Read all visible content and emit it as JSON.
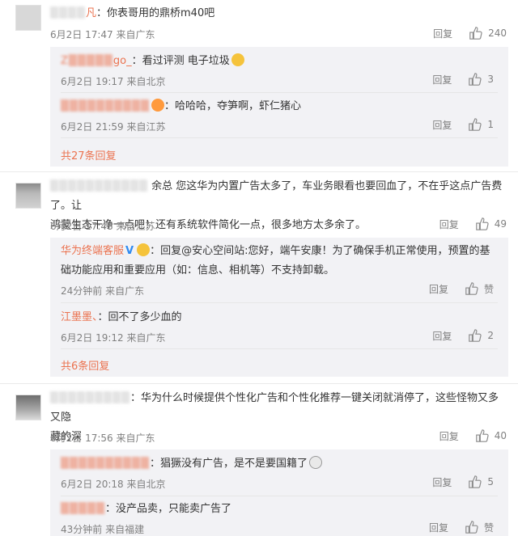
{
  "comments": [
    {
      "user": "凡",
      "text": "：你表哥用的鼎桥m40吧",
      "time": "6月2日 17:47 来自广东",
      "reply_label": "回复",
      "likes": "240",
      "replies": [
        {
          "user": "go_",
          "text": "：看过评测 电子垃圾",
          "time": "6月2日 19:17 来自北京",
          "reply_label": "回复",
          "likes": "3"
        },
        {
          "user": "",
          "text": "：哈哈哈，夺笋啊，虾仁猪心",
          "time": "6月2日 21:59 来自江苏",
          "reply_label": "回复",
          "likes": "1"
        }
      ],
      "more": "共27条回复"
    },
    {
      "user": "",
      "text_line1": "余总 您这华为内置广告太多了，车业务眼看也要回血了，不在乎这点广告费了。让",
      "text_line2": "鸿蒙生态干净一点吧！还有系统软件简化一点，很多地方太多余了。",
      "time": "6月2日 17:48 来自江苏",
      "reply_label": "回复",
      "likes": "49",
      "replies": [
        {
          "user": "华为终端客服",
          "text_line1": "：回复@安心空间站:您好，端午安康！为了确保手机正常使用，预置的基",
          "text_line2": "础功能应用和重要应用（如：信息、相机等）不支持卸载。",
          "time": "24分钟前 来自广东",
          "reply_label": "回复",
          "likes": "赞"
        },
        {
          "user": "江墨墨、",
          "text": "：回不了多少血的",
          "time": "6月2日 19:12 来自广东",
          "reply_label": "回复",
          "likes": "2"
        }
      ],
      "more": "共6条回复"
    },
    {
      "user": "",
      "text_line1": "：华为什么时候提供个性化广告和个性化推荐一键关闭就消停了，这些怪物又多又隐",
      "text_line2": "藏的深",
      "time": "6月2日 17:56 来自广东",
      "reply_label": "回复",
      "likes": "40",
      "replies": [
        {
          "user": "",
          "text": "：猖獗没有广告，是不是要国籍了",
          "time": "6月2日 20:18 来自北京",
          "reply_label": "回复",
          "likes": "5"
        },
        {
          "user": "",
          "text": "：没产品卖，只能卖广告了",
          "time": "43分钟前 来自福建",
          "reply_label": "回复",
          "likes": "赞"
        }
      ]
    }
  ],
  "colors": {
    "link": "#eb7350",
    "meta": "#808080",
    "replybox": "#f2f2f5"
  }
}
